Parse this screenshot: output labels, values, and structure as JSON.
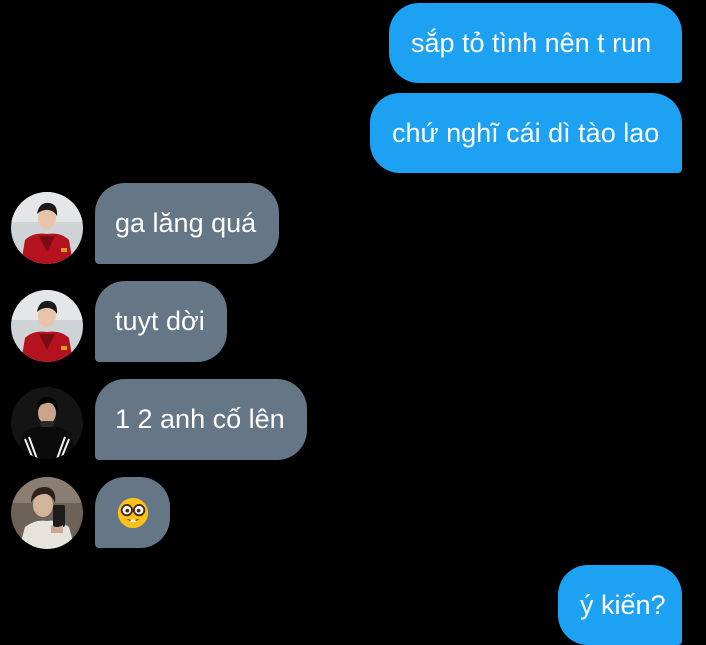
{
  "conversation": {
    "messages": [
      {
        "direction": "sent",
        "text": "sắp tỏ tình nên t run"
      },
      {
        "direction": "sent",
        "text": "chứ nghĩ cái dì tào lao"
      },
      {
        "direction": "received",
        "avatar": "avatar-red-jacket",
        "text": "ga lăng quá"
      },
      {
        "direction": "received",
        "avatar": "avatar-red-jacket",
        "text": "tuyt dời"
      },
      {
        "direction": "received",
        "avatar": "avatar-dark-jacket",
        "text": "1 2 anh cố lên"
      },
      {
        "direction": "received",
        "avatar": "avatar-phone-selfie",
        "emoji": "nerd-face-emoji"
      },
      {
        "direction": "sent",
        "text": "ý kiến?"
      }
    ]
  },
  "colors": {
    "background": "#000000",
    "sent_bubble": "#1da1f2",
    "received_bubble": "#657786",
    "text": "#ffffff"
  }
}
